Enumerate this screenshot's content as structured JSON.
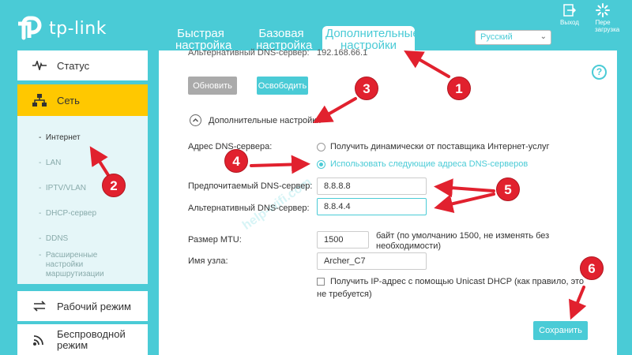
{
  "header": {
    "brand": "tp-link",
    "tabs": [
      {
        "label": "Быстрая настройка"
      },
      {
        "label": "Базовая настройка"
      },
      {
        "label": "Дополнительные настройки"
      }
    ],
    "language": "Русский",
    "logout_label": "Выход",
    "reboot_label": "Пере загрузка"
  },
  "sidebar": {
    "items": [
      {
        "label": "Статус",
        "icon": "pulse-icon"
      },
      {
        "label": "Сеть",
        "icon": "network-icon"
      },
      {
        "label": "Рабочий режим",
        "icon": "swap-icon"
      },
      {
        "label": "Беспроводной режим",
        "icon": "wifi-icon"
      }
    ],
    "sub_items": [
      {
        "label": "Интернет"
      },
      {
        "label": "LAN"
      },
      {
        "label": "IPTV/VLAN"
      },
      {
        "label": "DHCP-сервер"
      },
      {
        "label": "DDNS"
      },
      {
        "label": "Расширенные настройки маршрутизации"
      }
    ]
  },
  "main": {
    "top_alt_dns_label": "Альтернативный DNS-сервер:",
    "top_alt_dns_value": "192.168.66.1",
    "refresh_button": "Обновить",
    "release_button": "Освободить",
    "advanced_toggle": "Дополнительные настройки",
    "dns_address_label": "Адрес DNS-сервера:",
    "dns_option_auto": "Получить динамически от поставщика Интернет-услуг",
    "dns_option_manual": "Использовать следующие адреса DNS-серверов",
    "preferred_dns_label": "Предпочитаемый DNS-сервер:",
    "preferred_dns_value": "8.8.8.8",
    "alt_dns_label": "Альтернативный DNS-сервер:",
    "alt_dns_value": "8.8.4.4",
    "mtu_label": "Размер MTU:",
    "mtu_value": "1500",
    "mtu_hint_line1": "байт (по умолчанию 1500, не изменять без",
    "mtu_hint_line2": "необходимости)",
    "host_label": "Имя узла:",
    "host_value": "Archer_C7",
    "unicast_line1": "Получить IP-адрес с помощью Unicast DHCP (как правило, это",
    "unicast_line2": "не требуется)",
    "save_button": "Сохранить",
    "watermark": "help-wifi.com"
  },
  "annotations": {
    "markers": [
      "1",
      "2",
      "3",
      "4",
      "5",
      "6"
    ],
    "color": "#e1212e"
  },
  "colors": {
    "accent": "#4acbd6",
    "active_nav": "#ffc800"
  }
}
